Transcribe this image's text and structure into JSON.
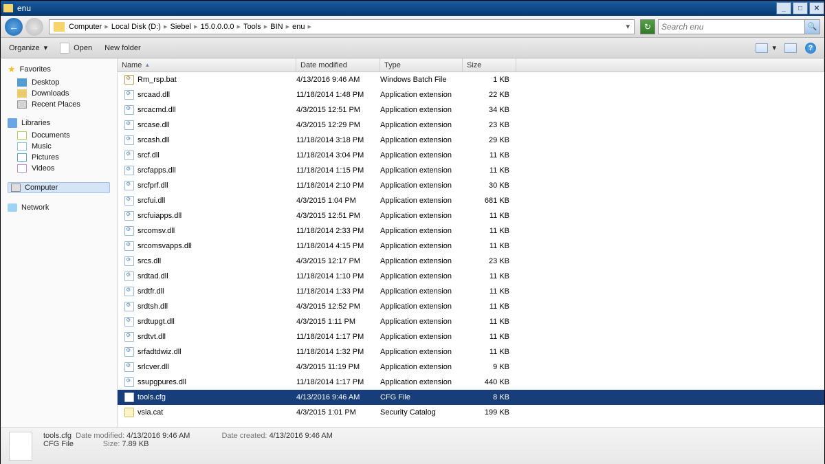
{
  "window": {
    "title": "enu"
  },
  "breadcrumb": [
    "Computer",
    "Local Disk (D:)",
    "Siebel",
    "15.0.0.0.0",
    "Tools",
    "BIN",
    "enu"
  ],
  "search": {
    "placeholder": "Search enu"
  },
  "toolbar": {
    "organize": "Organize",
    "open": "Open",
    "newfolder": "New folder"
  },
  "sidebar": {
    "favorites": {
      "header": "Favorites",
      "items": [
        "Desktop",
        "Downloads",
        "Recent Places"
      ]
    },
    "libraries": {
      "header": "Libraries",
      "items": [
        "Documents",
        "Music",
        "Pictures",
        "Videos"
      ]
    },
    "computer": "Computer",
    "network": "Network"
  },
  "columns": {
    "name": "Name",
    "date": "Date modified",
    "type": "Type",
    "size": "Size"
  },
  "files": [
    {
      "name": "Rm_rsp.bat",
      "date": "4/13/2016 9:46 AM",
      "type": "Windows Batch File",
      "size": "1 KB",
      "ico": "bat"
    },
    {
      "name": "srcaad.dll",
      "date": "11/18/2014 1:48 PM",
      "type": "Application extension",
      "size": "22 KB",
      "ico": "gear"
    },
    {
      "name": "srcacmd.dll",
      "date": "4/3/2015 12:51 PM",
      "type": "Application extension",
      "size": "34 KB",
      "ico": "gear"
    },
    {
      "name": "srcase.dll",
      "date": "4/3/2015 12:29 PM",
      "type": "Application extension",
      "size": "23 KB",
      "ico": "gear"
    },
    {
      "name": "srcash.dll",
      "date": "11/18/2014 3:18 PM",
      "type": "Application extension",
      "size": "29 KB",
      "ico": "gear"
    },
    {
      "name": "srcf.dll",
      "date": "11/18/2014 3:04 PM",
      "type": "Application extension",
      "size": "11 KB",
      "ico": "gear"
    },
    {
      "name": "srcfapps.dll",
      "date": "11/18/2014 1:15 PM",
      "type": "Application extension",
      "size": "11 KB",
      "ico": "gear"
    },
    {
      "name": "srcfprf.dll",
      "date": "11/18/2014 2:10 PM",
      "type": "Application extension",
      "size": "30 KB",
      "ico": "gear"
    },
    {
      "name": "srcfui.dll",
      "date": "4/3/2015 1:04 PM",
      "type": "Application extension",
      "size": "681 KB",
      "ico": "gear"
    },
    {
      "name": "srcfuiapps.dll",
      "date": "4/3/2015 12:51 PM",
      "type": "Application extension",
      "size": "11 KB",
      "ico": "gear"
    },
    {
      "name": "srcomsv.dll",
      "date": "11/18/2014 2:33 PM",
      "type": "Application extension",
      "size": "11 KB",
      "ico": "gear"
    },
    {
      "name": "srcomsvapps.dll",
      "date": "11/18/2014 4:15 PM",
      "type": "Application extension",
      "size": "11 KB",
      "ico": "gear"
    },
    {
      "name": "srcs.dll",
      "date": "4/3/2015 12:17 PM",
      "type": "Application extension",
      "size": "23 KB",
      "ico": "gear"
    },
    {
      "name": "srdtad.dll",
      "date": "11/18/2014 1:10 PM",
      "type": "Application extension",
      "size": "11 KB",
      "ico": "gear"
    },
    {
      "name": "srdtfr.dll",
      "date": "11/18/2014 1:33 PM",
      "type": "Application extension",
      "size": "11 KB",
      "ico": "gear"
    },
    {
      "name": "srdtsh.dll",
      "date": "4/3/2015 12:52 PM",
      "type": "Application extension",
      "size": "11 KB",
      "ico": "gear"
    },
    {
      "name": "srdtupgt.dll",
      "date": "4/3/2015 1:11 PM",
      "type": "Application extension",
      "size": "11 KB",
      "ico": "gear"
    },
    {
      "name": "srdtvt.dll",
      "date": "11/18/2014 1:17 PM",
      "type": "Application extension",
      "size": "11 KB",
      "ico": "gear"
    },
    {
      "name": "srfadtdwiz.dll",
      "date": "11/18/2014 1:32 PM",
      "type": "Application extension",
      "size": "11 KB",
      "ico": "gear"
    },
    {
      "name": "srlcver.dll",
      "date": "4/3/2015 11:19 PM",
      "type": "Application extension",
      "size": "9 KB",
      "ico": "gear"
    },
    {
      "name": "ssupgpures.dll",
      "date": "11/18/2014 1:17 PM",
      "type": "Application extension",
      "size": "440 KB",
      "ico": "gear"
    },
    {
      "name": "tools.cfg",
      "date": "4/13/2016 9:46 AM",
      "type": "CFG File",
      "size": "8 KB",
      "ico": "cfg",
      "selected": true
    },
    {
      "name": "vsia.cat",
      "date": "4/3/2015 1:01 PM",
      "type": "Security Catalog",
      "size": "199 KB",
      "ico": "cat"
    }
  ],
  "details": {
    "name": "tools.cfg",
    "type": "CFG File",
    "modified_label": "Date modified:",
    "modified": "4/13/2016 9:46 AM",
    "size_label": "Size:",
    "size": "7.89 KB",
    "created_label": "Date created:",
    "created": "4/13/2016 9:46 AM"
  }
}
